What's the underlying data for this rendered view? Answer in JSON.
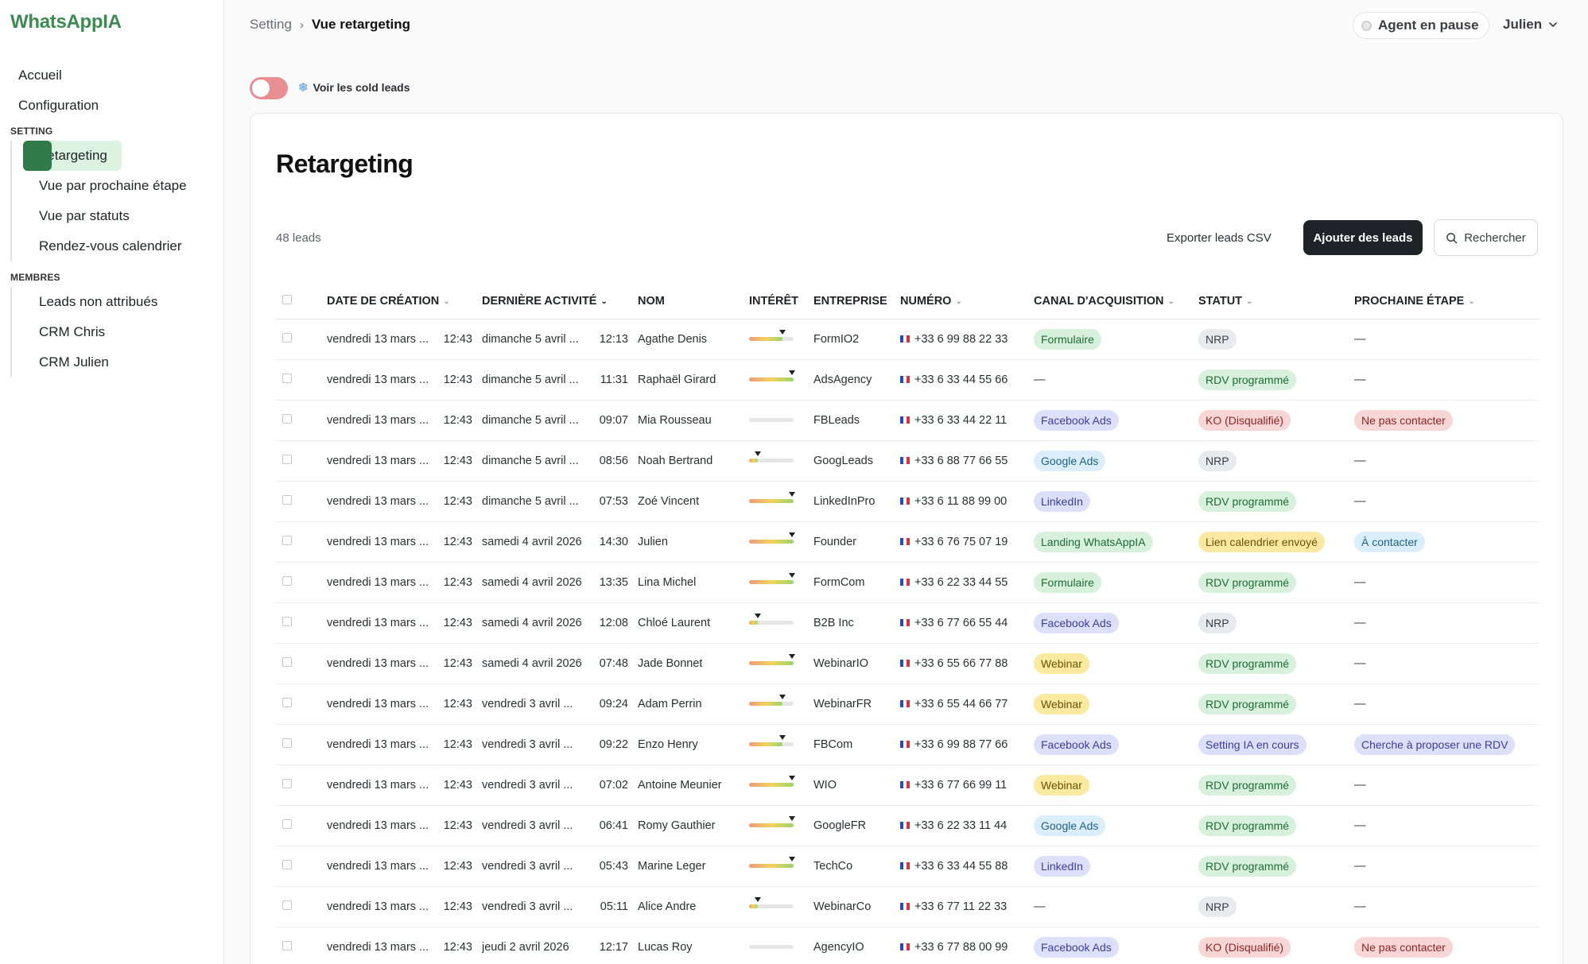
{
  "sidebar": {
    "brand": "WhatsAppIA",
    "top_items": [
      {
        "label": "Accueil"
      },
      {
        "label": "Configuration"
      }
    ],
    "setting_label": "SETTING",
    "setting_items": [
      {
        "label": "Retargeting",
        "active": true
      },
      {
        "label": "Vue par prochaine étape"
      },
      {
        "label": "Vue par statuts"
      },
      {
        "label": "Rendez-vous calendrier"
      }
    ],
    "membres_label": "MEMBRES",
    "membres_items": [
      {
        "label": "Leads non attribués"
      },
      {
        "label": "CRM Chris"
      },
      {
        "label": "CRM Julien"
      }
    ]
  },
  "header": {
    "breadcrumb_parent": "Setting",
    "breadcrumb_sep": "›",
    "breadcrumb_current": "Vue retargeting",
    "agent_status": "Agent en pause",
    "user_name": "Julien"
  },
  "toggle": {
    "label": "Voir les cold leads",
    "icon": "snowflake-icon",
    "on": false
  },
  "main": {
    "title": "Retargeting",
    "leads_count": "48 leads",
    "export_label": "Exporter leads CSV",
    "add_label": "Ajouter des leads",
    "search_label": "Rechercher"
  },
  "table": {
    "columns": [
      {
        "label": "DATE DE CRÉATION",
        "sortable": true
      },
      {
        "label": "DERNIÈRE ACTIVITÉ",
        "sortable": true
      },
      {
        "label": "NOM",
        "sortable": false
      },
      {
        "label": "INTÉRÊT",
        "sortable": false
      },
      {
        "label": "ENTREPRISE",
        "sortable": false
      },
      {
        "label": "NUMÉRO",
        "sortable": true
      },
      {
        "label": "CANAL D'ACQUISITION",
        "sortable": true
      },
      {
        "label": "STATUT",
        "sortable": true
      },
      {
        "label": "PROCHAINE ÉTAPE",
        "sortable": true
      }
    ],
    "rows": [
      {
        "created": "vendredi 13 mars ...",
        "created_time": "12:43",
        "activity": "dimanche 5 avril ...",
        "activity_time": "12:13",
        "name": "Agathe Denis",
        "interest": 0.75,
        "company": "FormIO2",
        "phone": "+33 6 99 88 22 33",
        "channel": "Formulaire",
        "channel_class": "b-formulaire",
        "status": "NRP",
        "status_class": "b-nrp",
        "next": "",
        "next_class": ""
      },
      {
        "created": "vendredi 13 mars ...",
        "created_time": "12:43",
        "activity": "dimanche 5 avril ...",
        "activity_time": "11:31",
        "name": "Raphaël Girard",
        "interest": 1.0,
        "company": "AdsAgency",
        "phone": "+33 6 33 44 55 66",
        "channel": "",
        "channel_class": "",
        "status": "RDV programmé",
        "status_class": "b-rdv",
        "next": "",
        "next_class": ""
      },
      {
        "created": "vendredi 13 mars ...",
        "created_time": "12:43",
        "activity": "dimanche 5 avril ...",
        "activity_time": "09:07",
        "name": "Mia Rousseau",
        "interest": 0.0,
        "company": "FBLeads",
        "phone": "+33 6 33 44 22 11",
        "channel": "Facebook Ads",
        "channel_class": "b-facebook",
        "status": "KO (Disqualifié)",
        "status_class": "b-ko",
        "next": "Ne pas contacter",
        "next_class": "b-nepas"
      },
      {
        "created": "vendredi 13 mars ...",
        "created_time": "12:43",
        "activity": "dimanche 5 avril ...",
        "activity_time": "08:56",
        "name": "Noah Bertrand",
        "interest": 0.2,
        "company": "GoogLeads",
        "phone": "+33 6 88 77 66 55",
        "channel": "Google Ads",
        "channel_class": "b-google",
        "status": "NRP",
        "status_class": "b-nrp",
        "next": "",
        "next_class": ""
      },
      {
        "created": "vendredi 13 mars ...",
        "created_time": "12:43",
        "activity": "dimanche 5 avril ...",
        "activity_time": "07:53",
        "name": "Zoé Vincent",
        "interest": 1.0,
        "company": "LinkedInPro",
        "phone": "+33 6 11 88 99 00",
        "channel": "LinkedIn",
        "channel_class": "b-linkedin",
        "status": "RDV programmé",
        "status_class": "b-rdv",
        "next": "",
        "next_class": ""
      },
      {
        "created": "vendredi 13 mars ...",
        "created_time": "12:43",
        "activity": "samedi 4 avril 2026",
        "activity_time": "14:30",
        "name": "Julien",
        "interest": 1.0,
        "company": "Founder",
        "phone": "+33 6 76 75 07 19",
        "channel": "Landing WhatsAppIA",
        "channel_class": "b-landing",
        "status": "Lien calendrier envoyé",
        "status_class": "b-lien",
        "next": "À contacter",
        "next_class": "b-acontacter"
      },
      {
        "created": "vendredi 13 mars ...",
        "created_time": "12:43",
        "activity": "samedi 4 avril 2026",
        "activity_time": "13:35",
        "name": "Lina Michel",
        "interest": 1.0,
        "company": "FormCom",
        "phone": "+33 6 22 33 44 55",
        "channel": "Formulaire",
        "channel_class": "b-formulaire",
        "status": "RDV programmé",
        "status_class": "b-rdv",
        "next": "",
        "next_class": ""
      },
      {
        "created": "vendredi 13 mars ...",
        "created_time": "12:43",
        "activity": "samedi 4 avril 2026",
        "activity_time": "12:08",
        "name": "Chloé Laurent",
        "interest": 0.2,
        "company": "B2B Inc",
        "phone": "+33 6 77 66 55 44",
        "channel": "Facebook Ads",
        "channel_class": "b-facebook",
        "status": "NRP",
        "status_class": "b-nrp",
        "next": "",
        "next_class": ""
      },
      {
        "created": "vendredi 13 mars ...",
        "created_time": "12:43",
        "activity": "samedi 4 avril 2026",
        "activity_time": "07:48",
        "name": "Jade Bonnet",
        "interest": 1.0,
        "company": "WebinarIO",
        "phone": "+33 6 55 66 77 88",
        "channel": "Webinar",
        "channel_class": "b-webinar",
        "status": "RDV programmé",
        "status_class": "b-rdv",
        "next": "",
        "next_class": ""
      },
      {
        "created": "vendredi 13 mars ...",
        "created_time": "12:43",
        "activity": "vendredi 3 avril ...",
        "activity_time": "09:24",
        "name": "Adam Perrin",
        "interest": 0.75,
        "company": "WebinarFR",
        "phone": "+33 6 55 44 66 77",
        "channel": "Webinar",
        "channel_class": "b-webinar",
        "status": "RDV programmé",
        "status_class": "b-rdv",
        "next": "",
        "next_class": ""
      },
      {
        "created": "vendredi 13 mars ...",
        "created_time": "12:43",
        "activity": "vendredi 3 avril ...",
        "activity_time": "09:22",
        "name": "Enzo Henry",
        "interest": 0.75,
        "company": "FBCom",
        "phone": "+33 6 99 88 77 66",
        "channel": "Facebook Ads",
        "channel_class": "b-facebook",
        "status": "Setting IA en cours",
        "status_class": "b-setting",
        "next": "Cherche à proposer une RDV",
        "next_class": "b-cherche"
      },
      {
        "created": "vendredi 13 mars ...",
        "created_time": "12:43",
        "activity": "vendredi 3 avril ...",
        "activity_time": "07:02",
        "name": "Antoine Meunier",
        "interest": 1.0,
        "company": "WIO",
        "phone": "+33 6 77 66 99 11",
        "channel": "Webinar",
        "channel_class": "b-webinar",
        "status": "RDV programmé",
        "status_class": "b-rdv",
        "next": "",
        "next_class": ""
      },
      {
        "created": "vendredi 13 mars ...",
        "created_time": "12:43",
        "activity": "vendredi 3 avril ...",
        "activity_time": "06:41",
        "name": "Romy Gauthier",
        "interest": 1.0,
        "company": "GoogleFR",
        "phone": "+33 6 22 33 11 44",
        "channel": "Google Ads",
        "channel_class": "b-google",
        "status": "RDV programmé",
        "status_class": "b-rdv",
        "next": "",
        "next_class": ""
      },
      {
        "created": "vendredi 13 mars ...",
        "created_time": "12:43",
        "activity": "vendredi 3 avril ...",
        "activity_time": "05:43",
        "name": "Marine Leger",
        "interest": 1.0,
        "company": "TechCo",
        "phone": "+33 6 33 44 55 88",
        "channel": "LinkedIn",
        "channel_class": "b-linkedin",
        "status": "RDV programmé",
        "status_class": "b-rdv",
        "next": "",
        "next_class": ""
      },
      {
        "created": "vendredi 13 mars ...",
        "created_time": "12:43",
        "activity": "vendredi 3 avril ...",
        "activity_time": "05:11",
        "name": "Alice Andre",
        "interest": 0.2,
        "company": "WebinarCo",
        "phone": "+33 6 77 11 22 33",
        "channel": "",
        "channel_class": "",
        "status": "NRP",
        "status_class": "b-nrp",
        "next": "",
        "next_class": ""
      },
      {
        "created": "vendredi 13 mars ...",
        "created_time": "12:43",
        "activity": "jeudi 2 avril 2026",
        "activity_time": "12:17",
        "name": "Lucas Roy",
        "interest": 0.0,
        "company": "AgencyIO",
        "phone": "+33 6 77 88 00 99",
        "channel": "Facebook Ads",
        "channel_class": "b-facebook",
        "status": "KO (Disqualifié)",
        "status_class": "b-ko",
        "next": "Ne pas contacter",
        "next_class": "b-nepas"
      }
    ],
    "empty_placeholder": "—"
  },
  "colors": {
    "brand": "#3d8a52",
    "active_nav_bg": "#ddf3e2",
    "toggle_off": "#e88f91",
    "primary_button": "#1f2328"
  }
}
